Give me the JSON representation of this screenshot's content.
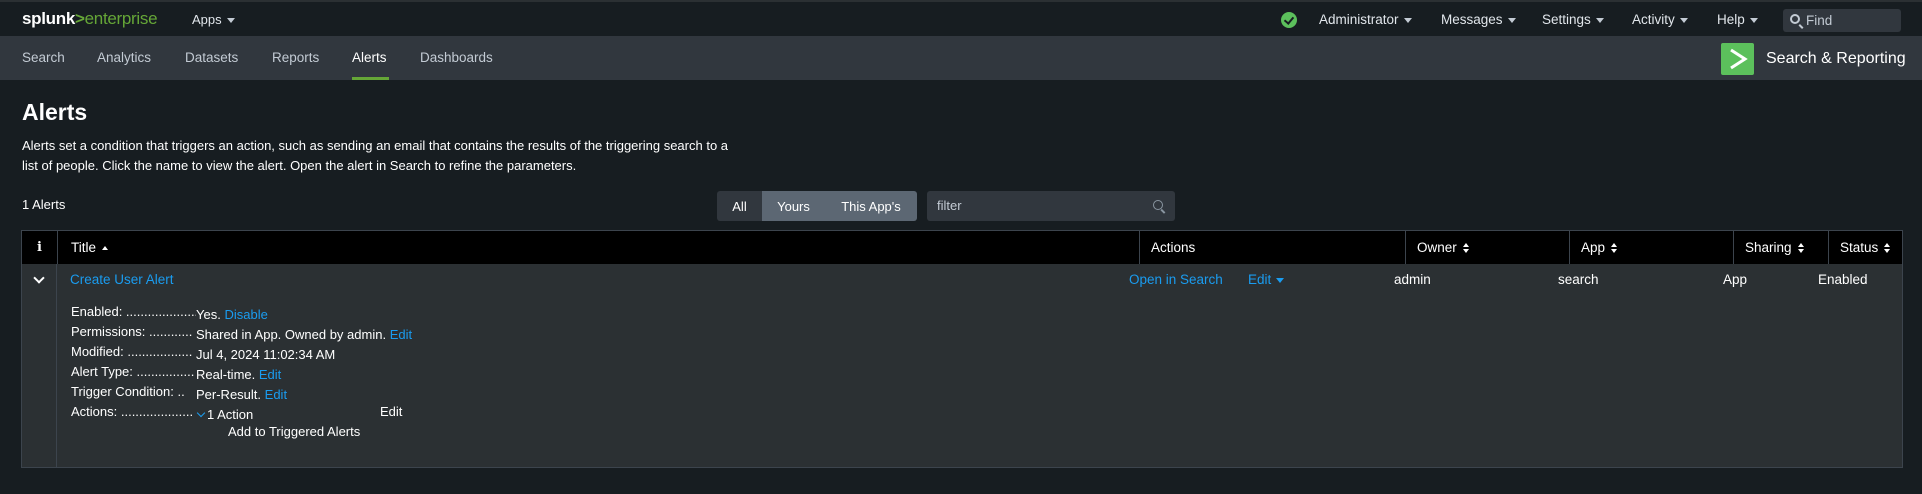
{
  "topbar": {
    "logo_main": "splunk",
    "logo_arrow": ">",
    "logo_suffix": "enterprise",
    "apps_label": "Apps",
    "menu": [
      "Administrator",
      "Messages",
      "Settings",
      "Activity",
      "Help"
    ],
    "find_placeholder": "Find"
  },
  "appnav": {
    "tabs": [
      "Search",
      "Analytics",
      "Datasets",
      "Reports",
      "Alerts",
      "Dashboards"
    ],
    "active_tab": "Alerts",
    "app_title": "Search & Reporting"
  },
  "page": {
    "title": "Alerts",
    "description": "Alerts set a condition that triggers an action, such as sending an email that contains the results of the triggering search to a list of people. Click the name to view the alert. Open the alert in Search to refine the parameters.",
    "count_label": "1 Alerts"
  },
  "filters": {
    "segments": [
      "All",
      "Yours",
      "This App's"
    ],
    "filter_placeholder": "filter"
  },
  "table": {
    "info_header": "i",
    "columns": [
      "Title",
      "Actions",
      "Owner",
      "App",
      "Sharing",
      "Status"
    ],
    "row": {
      "title": "Create User Alert",
      "open_in_search": "Open in Search",
      "edit": "Edit",
      "owner": "admin",
      "app": "search",
      "sharing": "App",
      "status": "Enabled"
    },
    "details": [
      {
        "key": "Enabled: ....................",
        "value": "Yes.",
        "link": "Disable"
      },
      {
        "key": "Permissions: ............",
        "value": "Shared in App. Owned by admin.",
        "link": "Edit"
      },
      {
        "key": "Modified: ..................",
        "value": "Jul 4, 2024 11:02:34 AM",
        "link": ""
      },
      {
        "key": "Alert Type: ................",
        "value": "Real-time.",
        "link": "Edit"
      },
      {
        "key": "Trigger Condition: ..",
        "value": "Per-Result.",
        "link": "Edit"
      },
      {
        "key": "Actions: ....................",
        "value": "1 Action",
        "link": "Edit"
      }
    ],
    "triggered_action": "Add to Triggered Alerts"
  },
  "colors": {
    "accent_green": "#65a637",
    "link_blue": "#1a9cf0",
    "header_bg": "#31373e"
  }
}
